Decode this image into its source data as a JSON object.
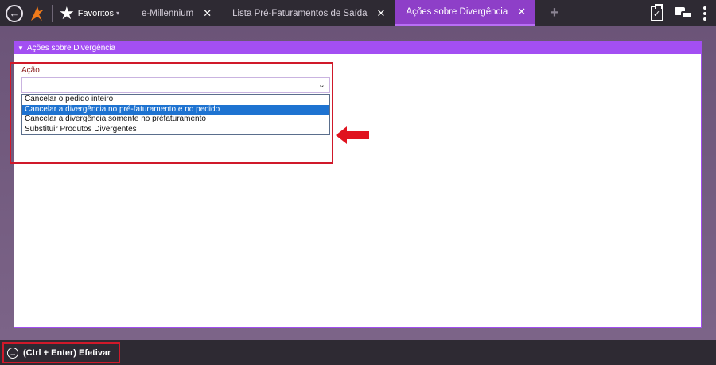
{
  "topbar": {
    "favorites_label": "Favoritos",
    "tabs": [
      {
        "label": "e-Millennium",
        "active": false
      },
      {
        "label": "Lista Pré-Faturamentos de Saída",
        "active": false
      },
      {
        "label": "Ações sobre Divergência",
        "active": true
      }
    ],
    "icons": [
      "back-arrow-icon",
      "millennium-logo",
      "star-icon",
      "close-icon",
      "add-tab-icon",
      "clipboard-check-icon",
      "chat-icon",
      "kebab-menu-icon"
    ]
  },
  "panel": {
    "title": "Ações sobre Divergência",
    "field_label": "Ação",
    "select_value": "",
    "options": [
      "Cancelar o pedido inteiro",
      "Cancelar a divergência no pré-faturamento e no pedido",
      "Cancelar a divergência somente no préfaturamento",
      "Substituir Produtos Divergentes"
    ],
    "selected_option_index": 1
  },
  "bottombar": {
    "efetivar_label": "(Ctrl + Enter) Efetivar"
  },
  "colors": {
    "accent": "#a34ff3",
    "active_tab": "#8e3fc8",
    "highlight": "#d0192a",
    "selection": "#1e73d1",
    "topbar_bg": "#2e2a33"
  }
}
